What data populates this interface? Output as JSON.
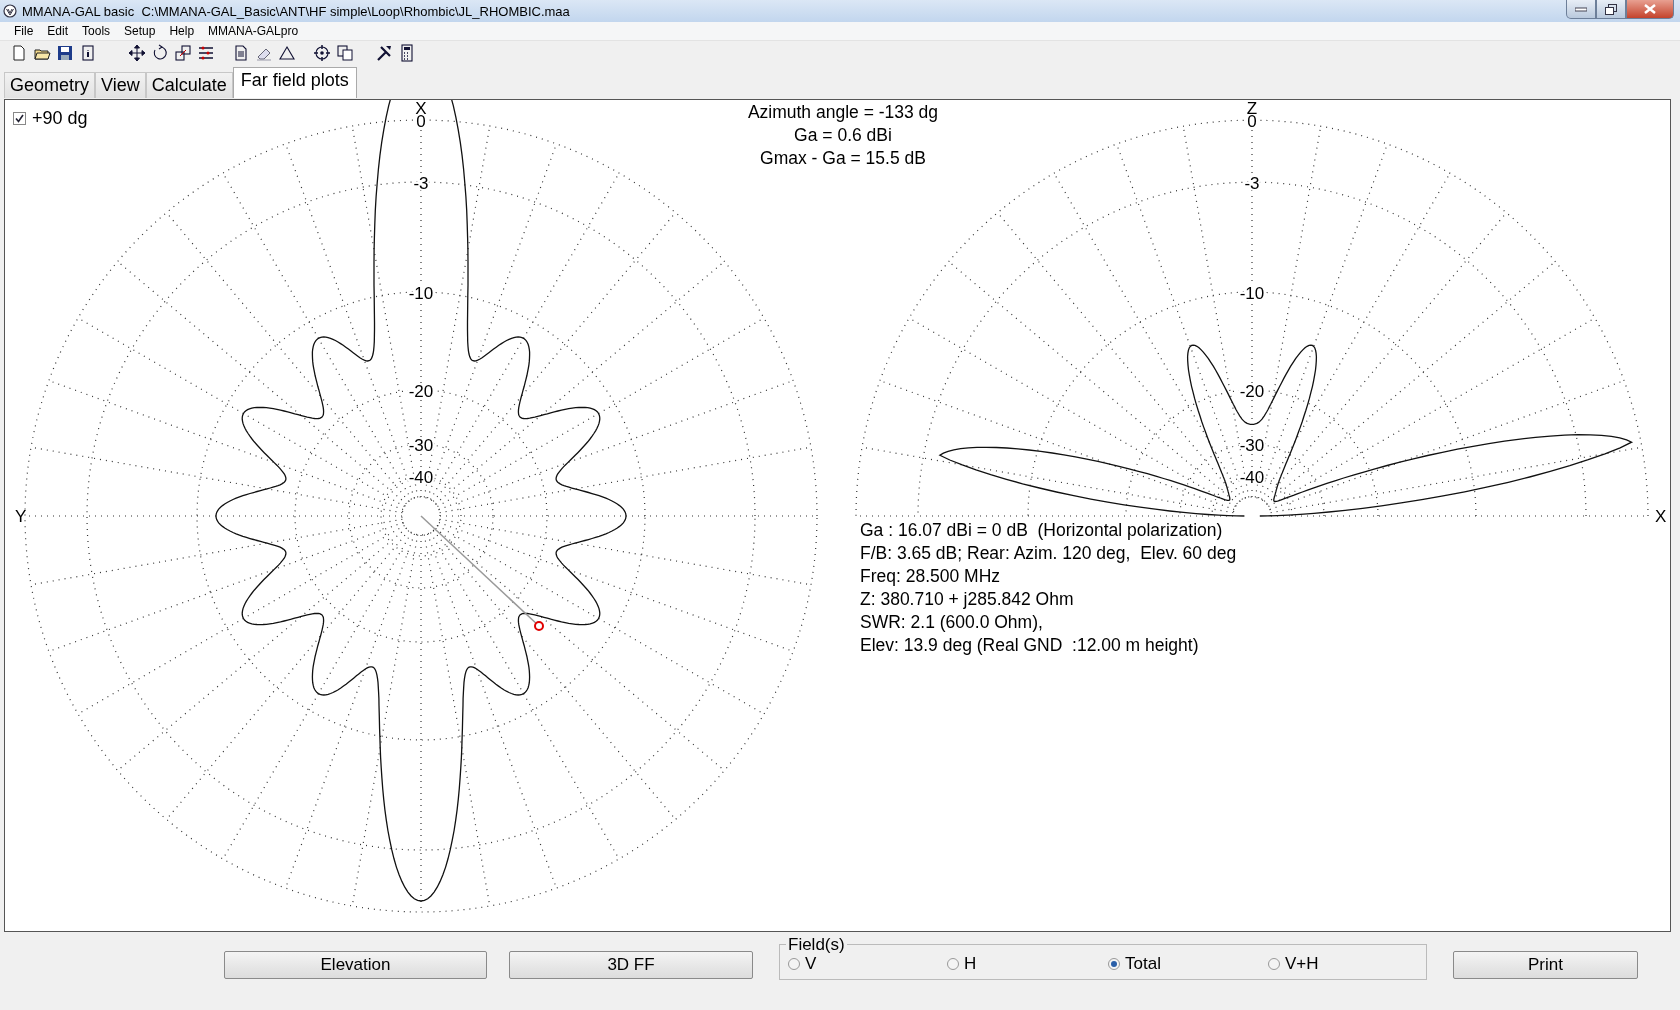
{
  "window": {
    "title": "MMANA-GAL basic  C:\\MMANA-GAL_Basic\\ANT\\HF simple\\Loop\\Rhombic\\JL_RHOMBIC.maa"
  },
  "menu": [
    "File",
    "Edit",
    "Tools",
    "Setup",
    "Help",
    "MMANA-GALpro"
  ],
  "tabs": [
    {
      "label": "Geometry",
      "selected": false
    },
    {
      "label": "View",
      "selected": false
    },
    {
      "label": "Calculate",
      "selected": false
    },
    {
      "label": "Far field plots",
      "selected": true
    }
  ],
  "plot": {
    "plus_90": {
      "label": "+90 dg",
      "checked": true
    },
    "azimuth_info": [
      "Azimuth angle = -133 dg",
      "Ga = 0.6 dBi",
      "Gmax - Ga = 15.5 dB"
    ],
    "horizontal_plot": {
      "top_axis": "X",
      "side_axis": "Y",
      "ring_labels": [
        "0",
        "-3",
        "-10",
        "-20",
        "-30",
        "-40"
      ]
    },
    "vertical_plot": {
      "top_axis": "Z",
      "side_axis": "X",
      "ring_labels": [
        "0",
        "-3",
        "-10",
        "-20",
        "-30",
        "-40"
      ]
    },
    "results": [
      "Ga : 16.07 dBi = 0 dB  (Horizontal polarization)",
      "F/B: 3.65 dB; Rear: Azim. 120 deg,  Elev. 60 deg",
      "Freq: 28.500 MHz",
      "Z: 380.710 + j285.842 Ohm",
      "SWR: 2.1 (600.0 Ohm),",
      "Elev: 13.9 deg (Real GND  :12.00 m height)"
    ]
  },
  "bottom": {
    "elevation_button": "Elevation",
    "ff3d_button": "3D FF",
    "fields": {
      "title": "Field(s)",
      "options": [
        {
          "label": "V",
          "selected": false
        },
        {
          "label": "H",
          "selected": false
        },
        {
          "label": "Total",
          "selected": true
        },
        {
          "label": "V+H",
          "selected": false
        }
      ]
    },
    "print_button": "Print"
  }
}
